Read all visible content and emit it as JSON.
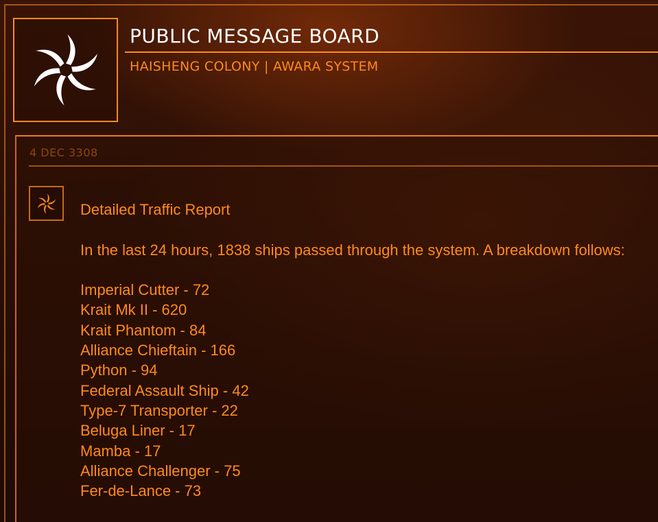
{
  "header": {
    "title": "PUBLIC MESSAGE BOARD",
    "subtitle": "HAISHENG COLONY | AWARA SYSTEM",
    "logo_icon": "spiral-faction-logo-icon"
  },
  "post": {
    "date": "4 DEC 3308",
    "icon": "spiral-faction-logo-icon",
    "heading": "Detailed Traffic Report",
    "intro": "In the last 24 hours, 1838 ships passed through the system. A breakdown follows:",
    "ships": [
      "Imperial Cutter - 72",
      "Krait Mk II - 620",
      "Krait Phantom - 84",
      "Alliance Chieftain - 166",
      "Python - 94",
      "Federal Assault Ship - 42",
      "Type-7 Transporter - 22",
      "Beluga Liner - 17",
      "Mamba - 17",
      "Alliance Challenger - 75",
      "Fer-de-Lance - 73"
    ]
  },
  "colors": {
    "accent": "#ff8a1a",
    "title": "#ffffff",
    "background": "#2a0f05"
  }
}
